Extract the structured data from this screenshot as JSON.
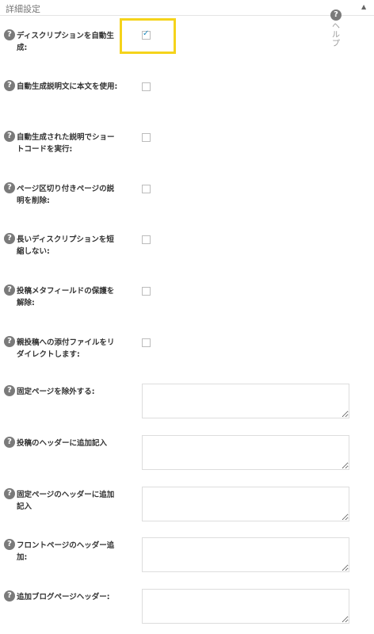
{
  "header": {
    "section_title": "詳細設定",
    "help_label": "ヘルプ",
    "help_icon": "question-circle-icon",
    "collapse_icon": "triangle-up-icon"
  },
  "colors": {
    "highlight": "#f5d31b",
    "checkmark": "#1e8cbe",
    "help_icon_bg": "#7a7a7a"
  },
  "settings": [
    {
      "label": "ディスクリプションを自動生成:",
      "type": "checkbox",
      "checked": true
    },
    {
      "label": "自動生成説明文に本文を使用:",
      "type": "checkbox",
      "checked": false
    },
    {
      "label": "自動生成された説明でショートコードを実行:",
      "type": "checkbox",
      "checked": false
    },
    {
      "label": "ページ区切り付きページの説明を削除:",
      "type": "checkbox",
      "checked": false
    },
    {
      "label": "長いディスクリプションを短縮しない:",
      "type": "checkbox",
      "checked": false
    },
    {
      "label": "投稿メタフィールドの保護を解除:",
      "type": "checkbox",
      "checked": false
    },
    {
      "label": "親投稿への添付ファイルをリダイレクトします:",
      "type": "checkbox",
      "checked": false
    },
    {
      "label": "固定ページを除外する:",
      "type": "textarea",
      "value": ""
    },
    {
      "label": "投稿のヘッダーに追加記入",
      "type": "textarea",
      "value": ""
    },
    {
      "label": "固定ページのヘッダーに追加記入",
      "type": "textarea",
      "value": ""
    },
    {
      "label": "フロントページのヘッダー追加:",
      "type": "textarea",
      "value": ""
    },
    {
      "label": "追加ブログページヘッダー:",
      "type": "textarea",
      "value": ""
    }
  ]
}
